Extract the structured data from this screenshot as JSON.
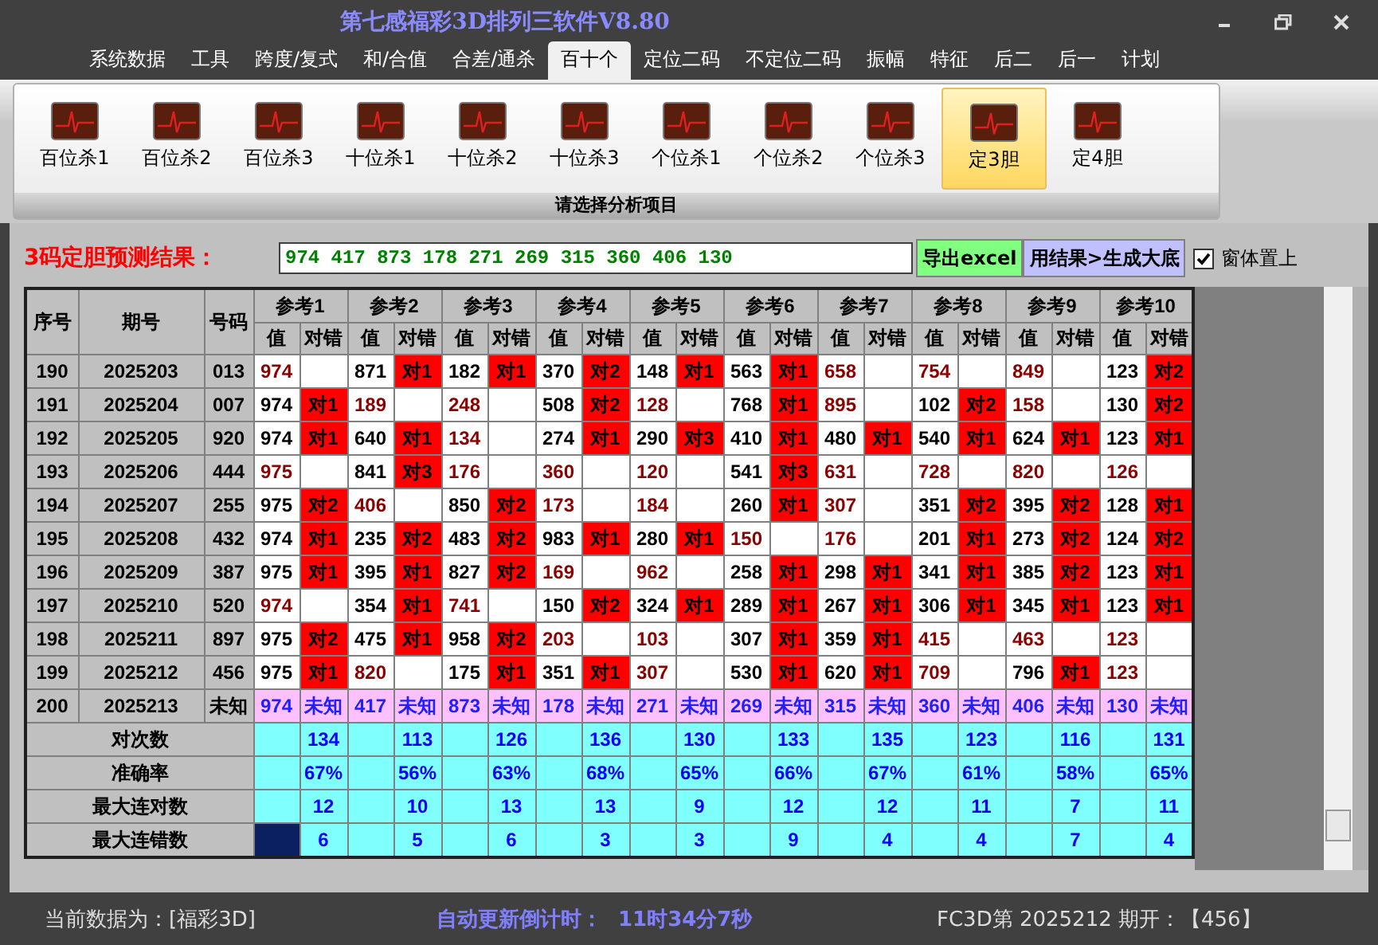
{
  "window": {
    "title": "第七感福彩3D排列三软件V8.80"
  },
  "menu_tabs": [
    {
      "label": "系统数据",
      "selected": false
    },
    {
      "label": "工具",
      "selected": false
    },
    {
      "label": "跨度/复式",
      "selected": false
    },
    {
      "label": "和/合值",
      "selected": false
    },
    {
      "label": "合差/通杀",
      "selected": false
    },
    {
      "label": "百十个",
      "selected": true
    },
    {
      "label": "定位二码",
      "selected": false
    },
    {
      "label": "不定位二码",
      "selected": false
    },
    {
      "label": "振幅",
      "selected": false
    },
    {
      "label": "特征",
      "selected": false
    },
    {
      "label": "后二",
      "selected": false
    },
    {
      "label": "后一",
      "selected": false
    },
    {
      "label": "计划",
      "selected": false
    }
  ],
  "ribbon": {
    "items": [
      {
        "label": "百位杀1",
        "selected": false
      },
      {
        "label": "百位杀2",
        "selected": false
      },
      {
        "label": "百位杀3",
        "selected": false
      },
      {
        "label": "十位杀1",
        "selected": false
      },
      {
        "label": "十位杀2",
        "selected": false
      },
      {
        "label": "十位杀3",
        "selected": false
      },
      {
        "label": "个位杀1",
        "selected": false
      },
      {
        "label": "个位杀2",
        "selected": false
      },
      {
        "label": "个位杀3",
        "selected": false
      },
      {
        "label": "定3胆",
        "selected": true
      },
      {
        "label": "定4胆",
        "selected": false
      }
    ],
    "group_label": "请选择分析项目"
  },
  "result_bar": {
    "label": "3码定胆预测结果：",
    "value": "974 417 873 178 271 269 315 360 406 130",
    "export_button": "导出excel",
    "generate_button": "用结果>生成大底",
    "stay_on_top": {
      "label": "窗体置上",
      "checked": true
    }
  },
  "table": {
    "columns": [
      "序号",
      "期号",
      "号码"
    ],
    "ref_headers": [
      {
        "label": "参考1",
        "sub": [
          "值",
          "对错"
        ]
      },
      {
        "label": "参考2",
        "sub": [
          "值",
          "对错"
        ]
      },
      {
        "label": "参考3",
        "sub": [
          "值",
          "对错"
        ]
      },
      {
        "label": "参考4",
        "sub": [
          "值",
          "对错"
        ]
      },
      {
        "label": "参考5",
        "sub": [
          "值",
          "对错"
        ]
      },
      {
        "label": "参考6",
        "sub": [
          "值",
          "对错"
        ]
      },
      {
        "label": "参考7",
        "sub": [
          "值",
          "对错"
        ]
      },
      {
        "label": "参考8",
        "sub": [
          "值",
          "对错"
        ]
      },
      {
        "label": "参考9",
        "sub": [
          "值",
          "对错"
        ]
      },
      {
        "label": "参考10",
        "sub": [
          "值",
          "对错"
        ]
      }
    ],
    "rows": [
      {
        "no": "190",
        "issue": "2025203",
        "code": "013",
        "cells": [
          {
            "value": "974",
            "hit": false
          },
          {
            "value": "871",
            "hit": true,
            "mark": "对1"
          },
          {
            "value": "182",
            "hit": true,
            "mark": "对1"
          },
          {
            "value": "370",
            "hit": true,
            "mark": "对2"
          },
          {
            "value": "148",
            "hit": true,
            "mark": "对1"
          },
          {
            "value": "563",
            "hit": true,
            "mark": "对1"
          },
          {
            "value": "658",
            "hit": false
          },
          {
            "value": "754",
            "hit": false
          },
          {
            "value": "849",
            "hit": false
          },
          {
            "value": "123",
            "hit": true,
            "mark": "对2"
          }
        ]
      },
      {
        "no": "191",
        "issue": "2025204",
        "code": "007",
        "cells": [
          {
            "value": "974",
            "hit": true,
            "mark": "对1"
          },
          {
            "value": "189",
            "hit": false
          },
          {
            "value": "248",
            "hit": false
          },
          {
            "value": "508",
            "hit": true,
            "mark": "对2"
          },
          {
            "value": "128",
            "hit": false
          },
          {
            "value": "768",
            "hit": true,
            "mark": "对1"
          },
          {
            "value": "895",
            "hit": false
          },
          {
            "value": "102",
            "hit": true,
            "mark": "对2"
          },
          {
            "value": "158",
            "hit": false
          },
          {
            "value": "130",
            "hit": true,
            "mark": "对2"
          }
        ]
      },
      {
        "no": "192",
        "issue": "2025205",
        "code": "920",
        "cells": [
          {
            "value": "974",
            "hit": true,
            "mark": "对1"
          },
          {
            "value": "640",
            "hit": true,
            "mark": "对1"
          },
          {
            "value": "134",
            "hit": false
          },
          {
            "value": "274",
            "hit": true,
            "mark": "对1"
          },
          {
            "value": "290",
            "hit": true,
            "mark": "对3"
          },
          {
            "value": "410",
            "hit": true,
            "mark": "对1"
          },
          {
            "value": "480",
            "hit": true,
            "mark": "对1"
          },
          {
            "value": "540",
            "hit": true,
            "mark": "对1"
          },
          {
            "value": "624",
            "hit": true,
            "mark": "对1"
          },
          {
            "value": "123",
            "hit": true,
            "mark": "对1"
          }
        ]
      },
      {
        "no": "193",
        "issue": "2025206",
        "code": "444",
        "cells": [
          {
            "value": "975",
            "hit": false
          },
          {
            "value": "841",
            "hit": true,
            "mark": "对3"
          },
          {
            "value": "176",
            "hit": false
          },
          {
            "value": "360",
            "hit": false
          },
          {
            "value": "120",
            "hit": false
          },
          {
            "value": "541",
            "hit": true,
            "mark": "对3"
          },
          {
            "value": "631",
            "hit": false
          },
          {
            "value": "728",
            "hit": false
          },
          {
            "value": "820",
            "hit": false
          },
          {
            "value": "126",
            "hit": false
          }
        ]
      },
      {
        "no": "194",
        "issue": "2025207",
        "code": "255",
        "cells": [
          {
            "value": "975",
            "hit": true,
            "mark": "对2"
          },
          {
            "value": "406",
            "hit": false
          },
          {
            "value": "850",
            "hit": true,
            "mark": "对2"
          },
          {
            "value": "173",
            "hit": false
          },
          {
            "value": "184",
            "hit": false
          },
          {
            "value": "260",
            "hit": true,
            "mark": "对1"
          },
          {
            "value": "307",
            "hit": false
          },
          {
            "value": "351",
            "hit": true,
            "mark": "对2"
          },
          {
            "value": "395",
            "hit": true,
            "mark": "对2"
          },
          {
            "value": "128",
            "hit": true,
            "mark": "对1"
          }
        ]
      },
      {
        "no": "195",
        "issue": "2025208",
        "code": "432",
        "cells": [
          {
            "value": "974",
            "hit": true,
            "mark": "对1"
          },
          {
            "value": "235",
            "hit": true,
            "mark": "对2"
          },
          {
            "value": "483",
            "hit": true,
            "mark": "对2"
          },
          {
            "value": "983",
            "hit": true,
            "mark": "对1"
          },
          {
            "value": "280",
            "hit": true,
            "mark": "对1"
          },
          {
            "value": "150",
            "hit": false
          },
          {
            "value": "176",
            "hit": false
          },
          {
            "value": "201",
            "hit": true,
            "mark": "对1"
          },
          {
            "value": "273",
            "hit": true,
            "mark": "对2"
          },
          {
            "value": "124",
            "hit": true,
            "mark": "对2"
          }
        ]
      },
      {
        "no": "196",
        "issue": "2025209",
        "code": "387",
        "cells": [
          {
            "value": "975",
            "hit": true,
            "mark": "对1"
          },
          {
            "value": "395",
            "hit": true,
            "mark": "对1"
          },
          {
            "value": "827",
            "hit": true,
            "mark": "对2"
          },
          {
            "value": "169",
            "hit": false
          },
          {
            "value": "962",
            "hit": false
          },
          {
            "value": "258",
            "hit": true,
            "mark": "对1"
          },
          {
            "value": "298",
            "hit": true,
            "mark": "对1"
          },
          {
            "value": "341",
            "hit": true,
            "mark": "对1"
          },
          {
            "value": "385",
            "hit": true,
            "mark": "对2"
          },
          {
            "value": "123",
            "hit": true,
            "mark": "对1"
          }
        ]
      },
      {
        "no": "197",
        "issue": "2025210",
        "code": "520",
        "cells": [
          {
            "value": "974",
            "hit": false
          },
          {
            "value": "354",
            "hit": true,
            "mark": "对1"
          },
          {
            "value": "741",
            "hit": false
          },
          {
            "value": "150",
            "hit": true,
            "mark": "对2"
          },
          {
            "value": "324",
            "hit": true,
            "mark": "对1"
          },
          {
            "value": "289",
            "hit": true,
            "mark": "对1"
          },
          {
            "value": "267",
            "hit": true,
            "mark": "对1"
          },
          {
            "value": "306",
            "hit": true,
            "mark": "对1"
          },
          {
            "value": "345",
            "hit": true,
            "mark": "对1"
          },
          {
            "value": "123",
            "hit": true,
            "mark": "对1"
          }
        ]
      },
      {
        "no": "198",
        "issue": "2025211",
        "code": "897",
        "cells": [
          {
            "value": "975",
            "hit": true,
            "mark": "对2"
          },
          {
            "value": "475",
            "hit": true,
            "mark": "对1"
          },
          {
            "value": "958",
            "hit": true,
            "mark": "对2"
          },
          {
            "value": "203",
            "hit": false
          },
          {
            "value": "103",
            "hit": false
          },
          {
            "value": "307",
            "hit": true,
            "mark": "对1"
          },
          {
            "value": "359",
            "hit": true,
            "mark": "对1"
          },
          {
            "value": "415",
            "hit": false
          },
          {
            "value": "463",
            "hit": false
          },
          {
            "value": "123",
            "hit": false
          }
        ]
      },
      {
        "no": "199",
        "issue": "2025212",
        "code": "456",
        "cells": [
          {
            "value": "975",
            "hit": true,
            "mark": "对1"
          },
          {
            "value": "820",
            "hit": false
          },
          {
            "value": "175",
            "hit": true,
            "mark": "对1"
          },
          {
            "value": "351",
            "hit": true,
            "mark": "对1"
          },
          {
            "value": "307",
            "hit": false
          },
          {
            "value": "530",
            "hit": true,
            "mark": "对1"
          },
          {
            "value": "620",
            "hit": true,
            "mark": "对1"
          },
          {
            "value": "709",
            "hit": false
          },
          {
            "value": "796",
            "hit": true,
            "mark": "对1"
          },
          {
            "value": "123",
            "hit": false
          }
        ]
      }
    ],
    "prediction_row": {
      "no": "200",
      "issue": "2025213",
      "code": "未知",
      "cells": [
        {
          "value": "974",
          "mark": "未知"
        },
        {
          "value": "417",
          "mark": "未知"
        },
        {
          "value": "873",
          "mark": "未知"
        },
        {
          "value": "178",
          "mark": "未知"
        },
        {
          "value": "271",
          "mark": "未知"
        },
        {
          "value": "269",
          "mark": "未知"
        },
        {
          "value": "315",
          "mark": "未知"
        },
        {
          "value": "360",
          "mark": "未知"
        },
        {
          "value": "406",
          "mark": "未知"
        },
        {
          "value": "130",
          "mark": "未知"
        }
      ]
    },
    "stats": [
      {
        "label": "对次数",
        "values": [
          "134",
          "113",
          "126",
          "136",
          "130",
          "133",
          "135",
          "123",
          "116",
          "131"
        ],
        "selected": false
      },
      {
        "label": "准确率",
        "values": [
          "67%",
          "56%",
          "63%",
          "68%",
          "65%",
          "66%",
          "67%",
          "61%",
          "58%",
          "65%"
        ],
        "selected": false
      },
      {
        "label": "最大连对数",
        "values": [
          "12",
          "10",
          "13",
          "13",
          "9",
          "12",
          "12",
          "11",
          "7",
          "11"
        ],
        "selected": false
      },
      {
        "label": "最大连错数",
        "values": [
          "6",
          "5",
          "6",
          "3",
          "3",
          "9",
          "4",
          "4",
          "7",
          "4"
        ],
        "selected": true
      }
    ]
  },
  "status_bar": {
    "data_source": "当前数据为：[福彩3D]",
    "countdown_label": "自动更新倒计时：",
    "countdown": "11时34分7秒",
    "last_draw": "FC3D第 2025212 期开：【456】"
  }
}
